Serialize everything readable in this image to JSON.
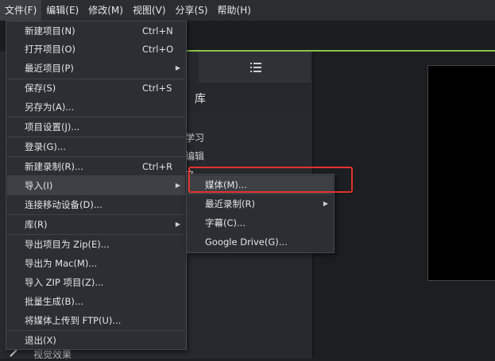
{
  "menubar": {
    "items": [
      {
        "label": "文件(F)"
      },
      {
        "label": "编辑(E)"
      },
      {
        "label": "修改(M)"
      },
      {
        "label": "视图(V)"
      },
      {
        "label": "分享(S)"
      },
      {
        "label": "帮助(H)"
      }
    ]
  },
  "library": {
    "title": "库",
    "items": [
      "学习",
      "编辑",
      "之一"
    ]
  },
  "bottom_panel": {
    "visual_effects_label": "视觉效果"
  },
  "file_menu": {
    "items": [
      {
        "label": "新建项目(N)",
        "shortcut": "Ctrl+N"
      },
      {
        "label": "打开项目(O)",
        "shortcut": "Ctrl+O"
      },
      {
        "label": "最近项目(P)",
        "shortcut": ""
      },
      {
        "label": "保存(S)",
        "shortcut": "Ctrl+S"
      },
      {
        "label": "另存为(A)...",
        "shortcut": ""
      },
      {
        "label": "项目设置(J)...",
        "shortcut": ""
      },
      {
        "label": "登录(G)...",
        "shortcut": ""
      },
      {
        "label": "新建录制(R)...",
        "shortcut": "Ctrl+R"
      },
      {
        "label": "导入(I)",
        "shortcut": ""
      },
      {
        "label": "连接移动设备(D)...",
        "shortcut": ""
      },
      {
        "label": "库(R)",
        "shortcut": ""
      },
      {
        "label": "导出项目为 Zip(E)...",
        "shortcut": ""
      },
      {
        "label": "导出为 Mac(M)...",
        "shortcut": ""
      },
      {
        "label": "导入 ZIP 项目(Z)...",
        "shortcut": ""
      },
      {
        "label": "批量生成(B)...",
        "shortcut": ""
      },
      {
        "label": "将媒体上传到 FTP(U)...",
        "shortcut": ""
      },
      {
        "label": "退出(X)",
        "shortcut": ""
      }
    ]
  },
  "import_submenu": {
    "items": [
      {
        "label": "媒体(M)..."
      },
      {
        "label": "最近录制(R)"
      },
      {
        "label": "字幕(C)..."
      },
      {
        "label": "Google Drive(G)..."
      }
    ]
  },
  "icons": {
    "submenu_arrow": "chevron-right-icon",
    "library_view": "list-view-icon"
  },
  "colors": {
    "accent": "#8bc34a",
    "annotation": "#e53030",
    "menu_bg": "#2b2e32",
    "highlight": "#3d4146"
  }
}
